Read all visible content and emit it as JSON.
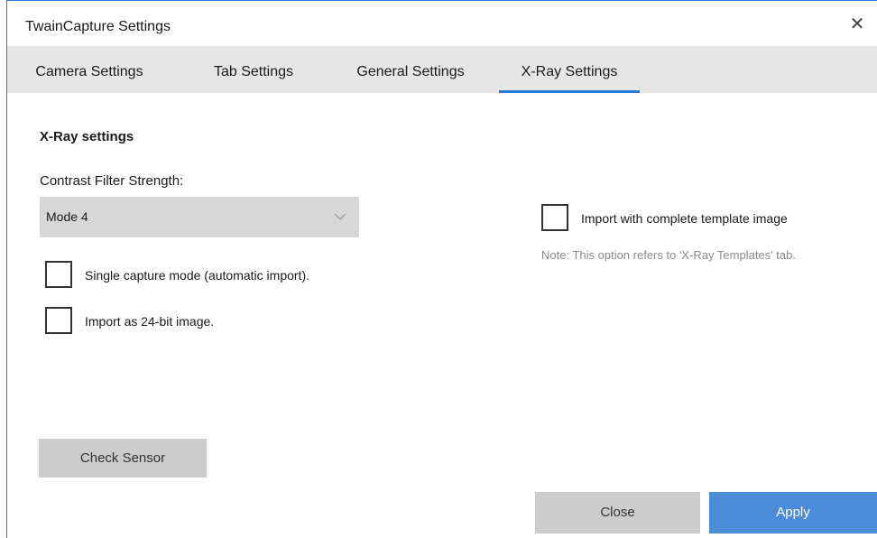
{
  "window": {
    "title": "TwainCapture Settings",
    "close_glyph": "✕"
  },
  "tabs": [
    {
      "label": "Camera Settings"
    },
    {
      "label": "Tab Settings"
    },
    {
      "label": "General Settings"
    },
    {
      "label": "X-Ray Settings",
      "active": true
    }
  ],
  "xray": {
    "section_title": "X-Ray settings",
    "contrast_label": "Contrast Filter Strength:",
    "contrast_value": "Mode 4",
    "single_capture_label": "Single capture mode (automatic import).",
    "single_capture_checked": false,
    "import_24bit_label": "Import as 24-bit image.",
    "import_24bit_checked": false,
    "import_template_label": "Import with complete template image",
    "import_template_checked": false,
    "note": "Note: This option refers to 'X-Ray Templates' tab."
  },
  "buttons": {
    "check_sensor": "Check Sensor",
    "close": "Close",
    "apply": "Apply"
  },
  "colors": {
    "accent": "#2b78d4",
    "apply_bg": "#4a8cda",
    "tab_bar_bg": "#e6e6e6",
    "button_gray": "#cccccc"
  },
  "icons": {
    "close": "close-icon",
    "dropdown": "chevron-down-icon"
  }
}
